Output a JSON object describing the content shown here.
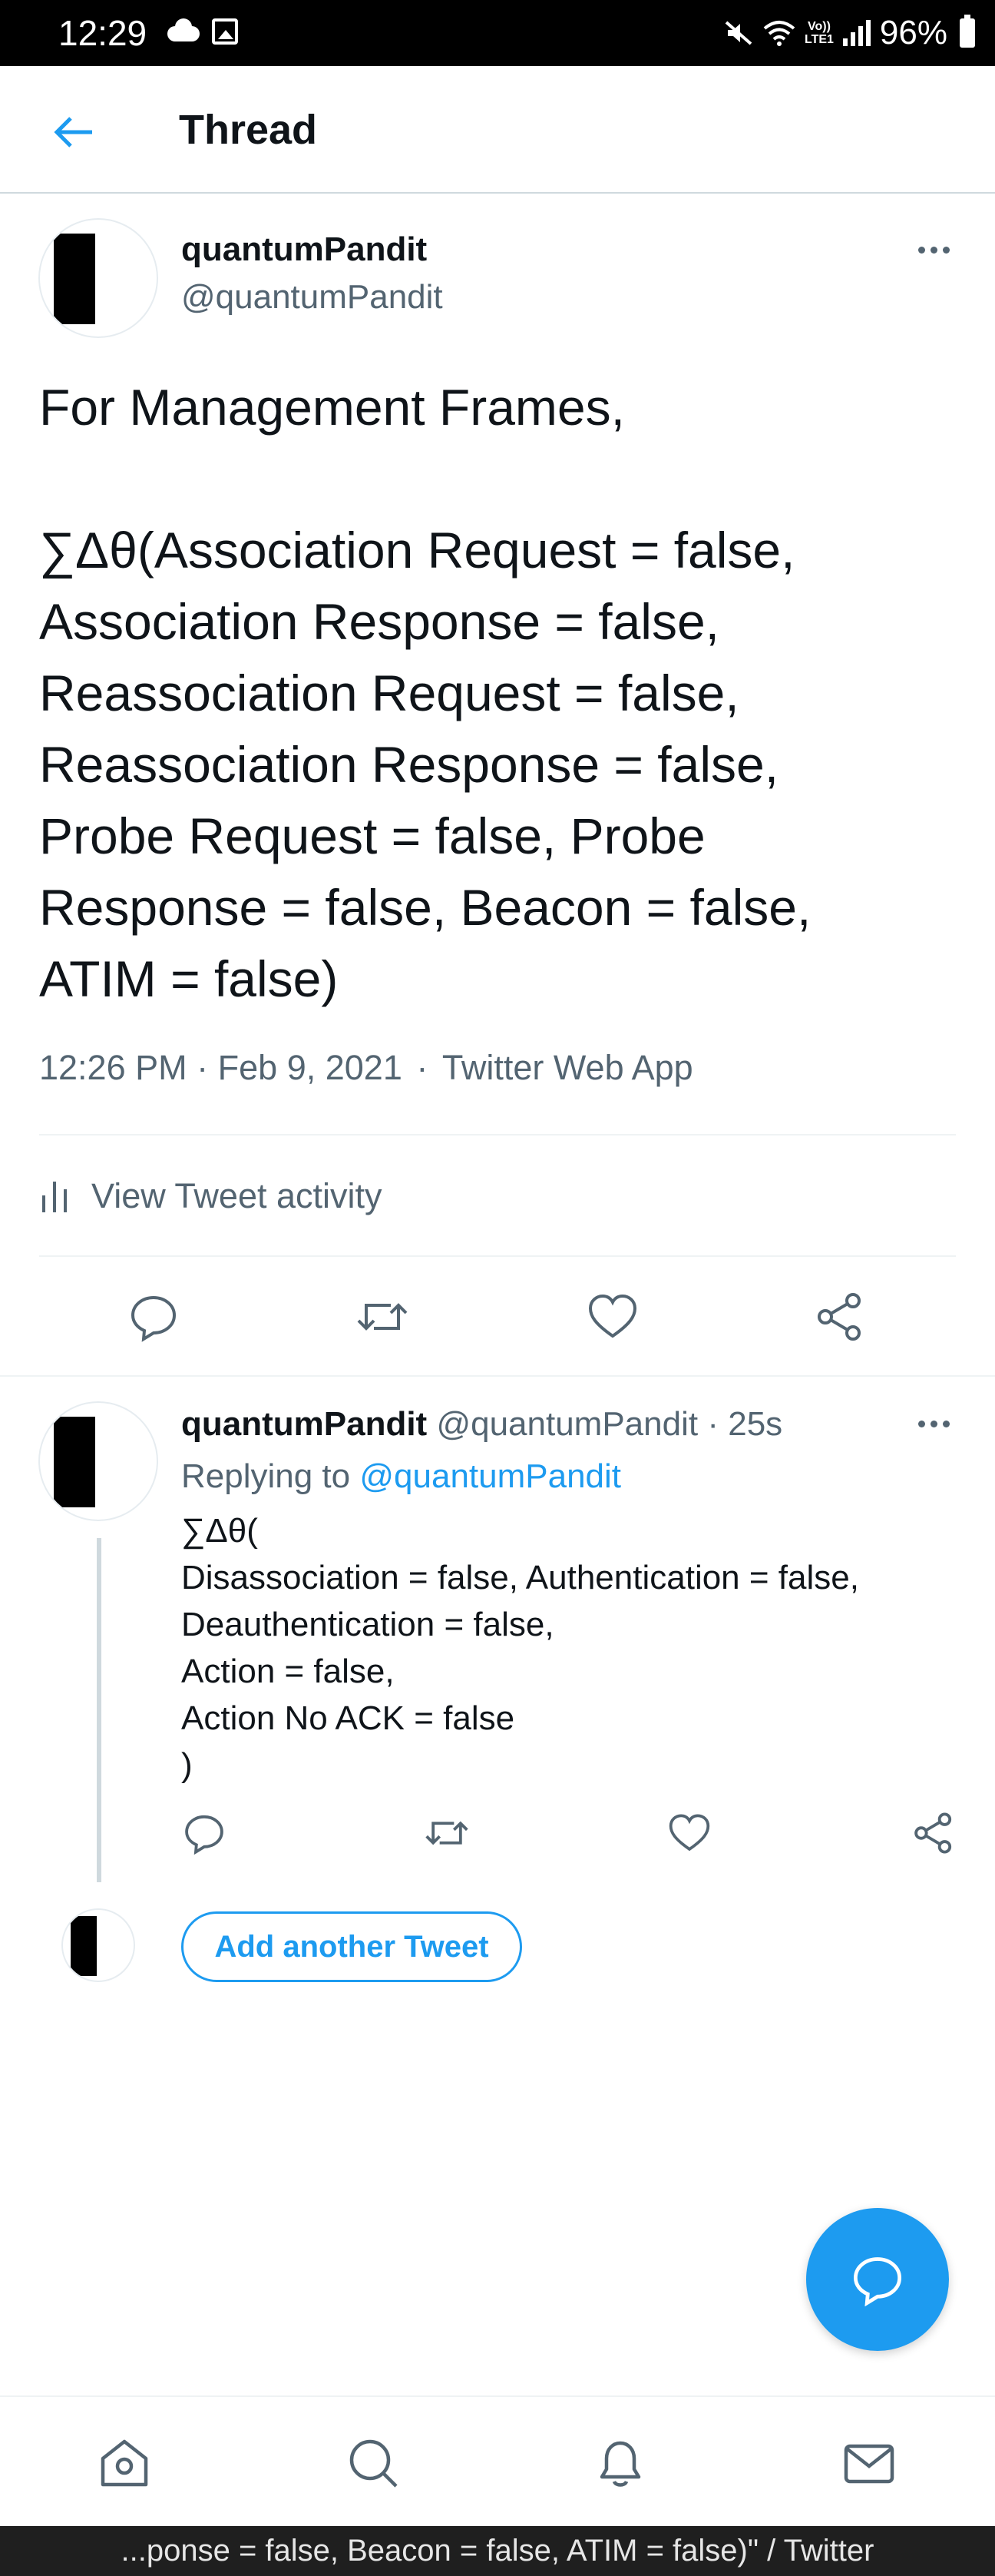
{
  "status_bar": {
    "time": "12:29",
    "volte_label_top": "Vo))",
    "volte_label_bottom": "LTE1",
    "battery": "96%"
  },
  "header": {
    "title": "Thread",
    "back_icon": "arrow-left-icon"
  },
  "main_tweet": {
    "display_name": "quantumPandit",
    "handle": "@quantumPandit",
    "text": "For Management Frames,\n\n∑Δθ(Association Request = false,\nAssociation Response = false,\nReassociation Request = false,\nReassociation Response = false,\nProbe Request = false, Probe\nResponse = false, Beacon = false,\nATIM = false)",
    "time": "12:26 PM",
    "date": "Feb 9, 2021",
    "source": "Twitter Web App",
    "separator": "·",
    "activity_label": "View Tweet activity"
  },
  "reply_tweet": {
    "display_name": "quantumPandit",
    "handle": "@quantumPandit",
    "age": "25s",
    "separator": "·",
    "replying_prefix": "Replying to",
    "replying_to": "@quantumPandit",
    "text": "∑Δθ(\nDisassociation = false, Authentication = false,\nDeauthentication = false,\nAction = false,\nAction No ACK = false\n)"
  },
  "composer": {
    "add_label": "Add another Tweet"
  },
  "bottom_nav": {
    "items": [
      "home-icon",
      "search-icon",
      "notifications-icon",
      "messages-icon"
    ]
  },
  "system_bar": {
    "page_title": "...ponse = false, Beacon = false, ATIM = false)\" / Twitter"
  },
  "colors": {
    "accent": "#1d9bf0",
    "text": "#0f1419",
    "muted": "#536471",
    "divider": "#eff3f4"
  }
}
